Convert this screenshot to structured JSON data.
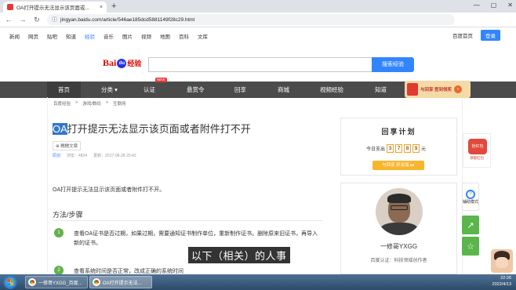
{
  "browser": {
    "tab_title": "OA打开提示无法显示该页面或...",
    "tab_close": "×",
    "new_tab": "+",
    "window_controls": [
      "—",
      "▢",
      "✕"
    ],
    "url": "jingyan.baidu.com/article/546ae185dcd5881149f28c29.html"
  },
  "top_nav": {
    "items": [
      "新闻",
      "网页",
      "贴吧",
      "知道",
      "经验",
      "音乐",
      "图片",
      "视频",
      "地图",
      "百科",
      "文库"
    ],
    "active_index": 4,
    "home_link": "百度首页",
    "login": "登录"
  },
  "search": {
    "logo_bai": "Bai",
    "logo_du": "du",
    "logo_jingyan": "经验",
    "button": "搜索经验"
  },
  "category_nav": {
    "items": [
      "首页",
      "分类 ▾",
      "认证",
      "悬赏令",
      "回享",
      "商城",
      "视频经验",
      "知道"
    ],
    "new_badge": "NEW",
    "promo_text": "与回享 签到领奖"
  },
  "breadcrumb": [
    "百度经验",
    ">",
    "游戏/数码",
    ">",
    "互联网"
  ],
  "article": {
    "title_highlight": "OA",
    "title_rest": "打开提示无法显示该页面或者附件打不开",
    "tag": "⊕ 糯糯文章",
    "meta_original": "原创",
    "meta_views": "浏览：4824",
    "meta_updated": "更新：2017-06-28 20:42",
    "intro": "OA打开提示无法显示该页面或者附件打不开。",
    "section_title": "方法/步骤",
    "steps": [
      {
        "num": "1",
        "text": "查看OA证书是否过期，如果过期，需要通知证书制作单位，重新制作证书。删除原来旧证书，再导入新的证书。"
      },
      {
        "num": "2",
        "text": "查看系统时间是否正常，改成正确的系统时间"
      }
    ],
    "caption_overlay": "以下（相关）的人事"
  },
  "sidebar": {
    "plan_title": "回享计划",
    "today_label": "今日支出",
    "digits": [
      "3",
      "7",
      "8",
      "9"
    ],
    "unit": "元",
    "plan_button": "与回享 好说瓶 ▸▸",
    "author_name": "一修哥YXGG",
    "author_cert": "百度认证：科技领域创作者"
  },
  "float_tools": {
    "redpacket_label": "抢红包",
    "redpacket_sub": "领取红包",
    "help_icon": "?",
    "help_text": "辅助模式",
    "share_icon": "↗",
    "fav_icon": "☆"
  },
  "taskbar": {
    "items": [
      "一修哥YXGG_百度...",
      "OA打开提示无法..."
    ],
    "time": "22:26",
    "date": "2022/4/13"
  }
}
